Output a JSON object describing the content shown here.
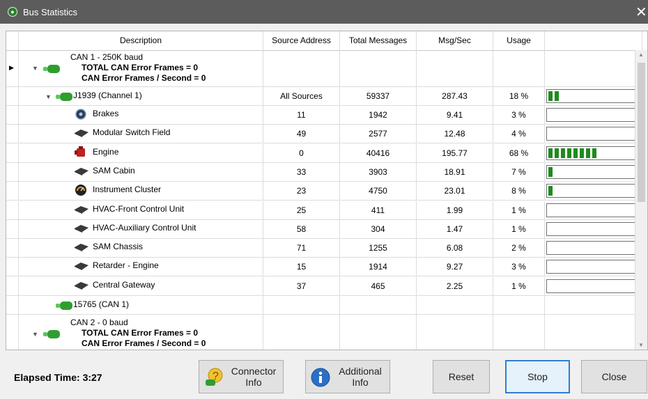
{
  "window": {
    "title": "Bus Statistics",
    "close_label": "✕"
  },
  "columns": [
    "Description",
    "Source Address",
    "Total Messages",
    "Msg/Sec",
    "Usage"
  ],
  "can1": {
    "title": "CAN 1 - 250K baud",
    "line2": "TOTAL CAN Error Frames = 0",
    "line3": "CAN Error Frames / Second = 0"
  },
  "j1939": {
    "name": "J1939 (Channel 1)",
    "src": "All Sources",
    "total": "59337",
    "rate": "287.43",
    "usage": "18 %",
    "bar_fraction": 0.18
  },
  "devices": [
    {
      "name": "Brakes",
      "icon": "brakes-icon",
      "src": "11",
      "total": "1942",
      "rate": "9.41",
      "usage": "3 %",
      "bar_fraction": 0.03
    },
    {
      "name": "Modular Switch Field",
      "icon": "ecu-module-icon",
      "src": "49",
      "total": "2577",
      "rate": "12.48",
      "usage": "4 %",
      "bar_fraction": 0.04
    },
    {
      "name": "Engine",
      "icon": "engine-icon",
      "src": "0",
      "total": "40416",
      "rate": "195.77",
      "usage": "68 %",
      "bar_fraction": 0.68
    },
    {
      "name": "SAM Cabin",
      "icon": "ecu-module-icon",
      "src": "33",
      "total": "3903",
      "rate": "18.91",
      "usage": "7 %",
      "bar_fraction": 0.07
    },
    {
      "name": "Instrument Cluster",
      "icon": "gauge-icon",
      "src": "23",
      "total": "4750",
      "rate": "23.01",
      "usage": "8 %",
      "bar_fraction": 0.08
    },
    {
      "name": "HVAC-Front Control Unit",
      "icon": "ecu-module-icon",
      "src": "25",
      "total": "411",
      "rate": "1.99",
      "usage": "1 %",
      "bar_fraction": 0.01
    },
    {
      "name": "HVAC-Auxiliary Control Unit",
      "icon": "ecu-module-icon",
      "src": "58",
      "total": "304",
      "rate": "1.47",
      "usage": "1 %",
      "bar_fraction": 0.01
    },
    {
      "name": "SAM Chassis",
      "icon": "ecu-module-icon",
      "src": "71",
      "total": "1255",
      "rate": "6.08",
      "usage": "2 %",
      "bar_fraction": 0.02
    },
    {
      "name": "Retarder - Engine",
      "icon": "ecu-module-icon",
      "src": "15",
      "total": "1914",
      "rate": "9.27",
      "usage": "3 %",
      "bar_fraction": 0.03
    },
    {
      "name": "Central Gateway",
      "icon": "ecu-module-icon",
      "src": "37",
      "total": "465",
      "rate": "2.25",
      "usage": "1 %",
      "bar_fraction": 0.01
    }
  ],
  "can_15765": {
    "name": "15765 (CAN 1)"
  },
  "can2": {
    "title": "CAN 2 - 0 baud",
    "line2": "TOTAL CAN Error Frames = 0",
    "line3": "CAN Error Frames / Second = 0"
  },
  "footer": {
    "elapsed_label": "Elapsed Time:",
    "elapsed_value": "3:27",
    "connector_info": "Connector\nInfo",
    "additional_info": "Additional\nInfo",
    "reset": "Reset",
    "stop": "Stop",
    "close": "Close"
  },
  "colors": {
    "bar_green": "#1e8b1e",
    "titlebar": "#5c5c5c",
    "primary_border": "#2d7fd2"
  }
}
